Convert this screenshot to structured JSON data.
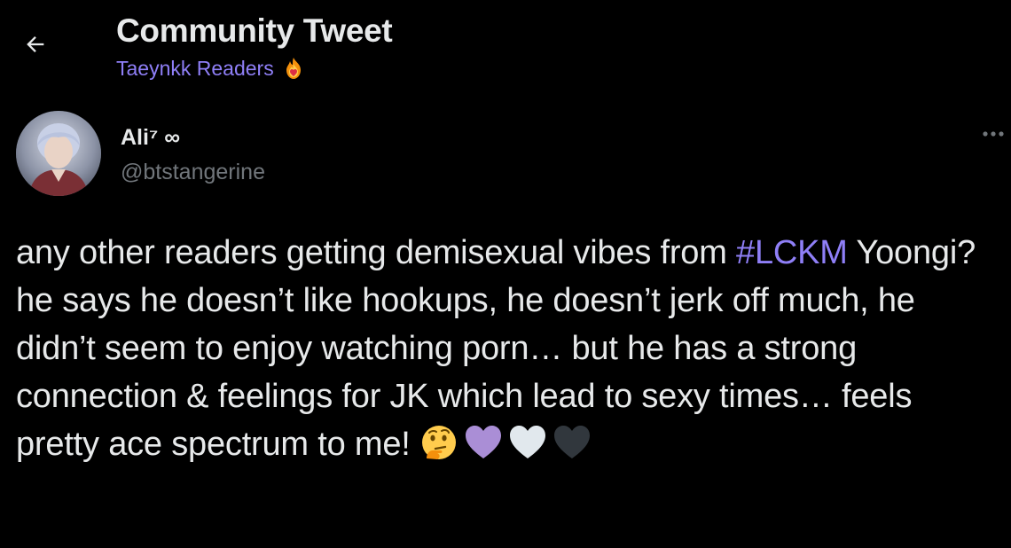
{
  "header": {
    "title": "Community Tweet",
    "community_name": "Taeynkk Readers",
    "community_badge_icon": "fire-heart-icon"
  },
  "author": {
    "display_name": "Ali⁷ ∞",
    "handle": "@btstangerine",
    "avatar_icon": "user-avatar"
  },
  "tweet": {
    "text_before": "any other readers getting demisexual vibes from ",
    "hashtag": "#LCKM",
    "text_after": " Yoongi? he says he doesn’t like hookups, he doesn’t jerk off much, he didn’t seem to enjoy watching porn… but he has a strong connection & feelings for JK which lead to sexy times… feels pretty ace spectrum to me! ",
    "emojis": [
      "thinking-face-icon",
      "purple-heart-icon",
      "white-heart-icon",
      "black-heart-icon"
    ]
  },
  "colors": {
    "background": "#000000",
    "text": "#e7e9ea",
    "muted": "#71767b",
    "accent": "#8f7ff7"
  }
}
